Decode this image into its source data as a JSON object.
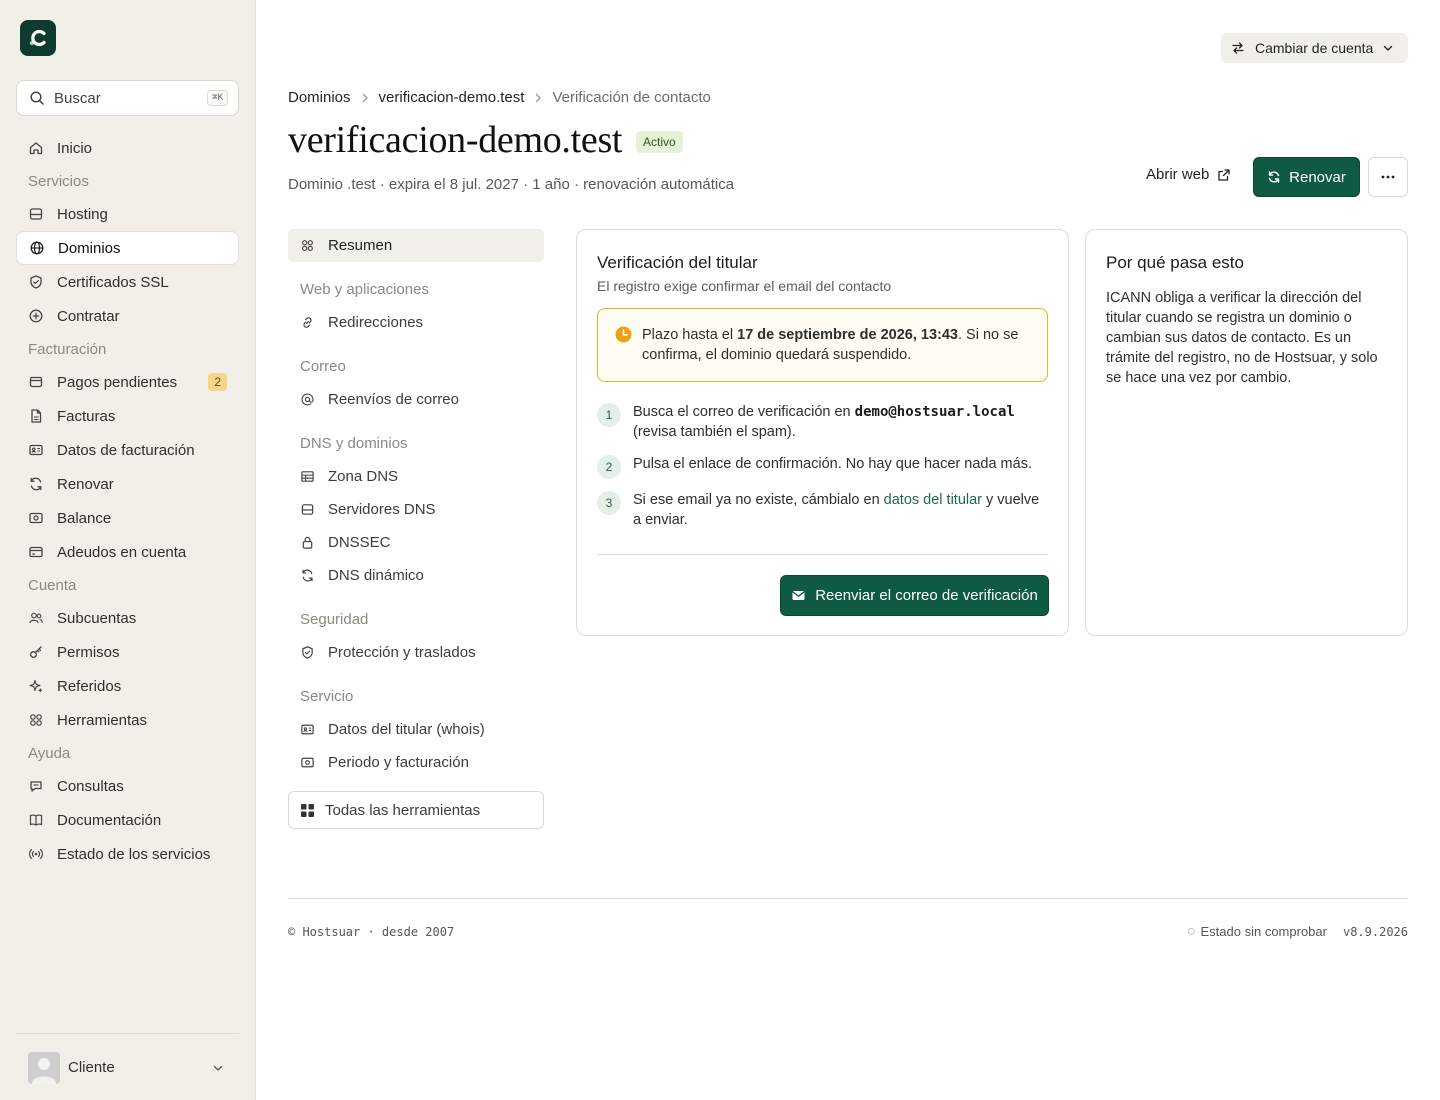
{
  "app": {
    "logo_letter": "C"
  },
  "search": {
    "placeholder": "Buscar",
    "shortcut": "⌘K"
  },
  "sidebar": {
    "items": [
      {
        "type": "item",
        "label": "Inicio",
        "icon": "home-icon"
      },
      {
        "type": "section",
        "label": "Servicios"
      },
      {
        "type": "item",
        "label": "Hosting",
        "icon": "server-icon"
      },
      {
        "type": "item",
        "label": "Dominios",
        "icon": "globe-icon",
        "active": true
      },
      {
        "type": "item",
        "label": "Certificados SSL",
        "icon": "shield-icon"
      },
      {
        "type": "item",
        "label": "Contratar",
        "icon": "plus-circle-icon"
      },
      {
        "type": "section",
        "label": "Facturación"
      },
      {
        "type": "item",
        "label": "Pagos pendientes",
        "icon": "wallet-icon",
        "badge": "2"
      },
      {
        "type": "item",
        "label": "Facturas",
        "icon": "file-icon"
      },
      {
        "type": "item",
        "label": "Datos de facturación",
        "icon": "id-card-icon"
      },
      {
        "type": "item",
        "label": "Renovar",
        "icon": "refresh-icon"
      },
      {
        "type": "item",
        "label": "Balance",
        "icon": "banknote-icon"
      },
      {
        "type": "item",
        "label": "Adeudos en cuenta",
        "icon": "credit-card-icon"
      },
      {
        "type": "section",
        "label": "Cuenta"
      },
      {
        "type": "item",
        "label": "Subcuentas",
        "icon": "users-icon"
      },
      {
        "type": "item",
        "label": "Permisos",
        "icon": "key-icon"
      },
      {
        "type": "item",
        "label": "Referidos",
        "icon": "sparkles-icon"
      },
      {
        "type": "item",
        "label": "Herramientas",
        "icon": "grid-icon"
      },
      {
        "type": "section",
        "label": "Ayuda"
      },
      {
        "type": "item",
        "label": "Consultas",
        "icon": "chat-icon"
      },
      {
        "type": "item",
        "label": "Documentación",
        "icon": "book-icon"
      },
      {
        "type": "item",
        "label": "Estado de los servicios",
        "icon": "broadcast-icon"
      }
    ]
  },
  "user": {
    "name": "Cliente"
  },
  "header": {
    "switch_account": "Cambiar de cuenta"
  },
  "breadcrumb": {
    "root": "Dominios",
    "domain": "verificacion-demo.test",
    "current": "Verificación de contacto"
  },
  "page": {
    "title": "verificacion-demo.test",
    "status": "Activo",
    "subtitle": "Dominio .test · expira el 8 jul. 2027 · 1 año · renovación automática",
    "open_web": "Abrir web",
    "renew": "Renovar"
  },
  "subnav": {
    "items": [
      {
        "type": "item",
        "label": "Resumen",
        "icon": "grid-icon",
        "active": true
      },
      {
        "type": "section",
        "label": "Web y aplicaciones"
      },
      {
        "type": "item",
        "label": "Redirecciones",
        "icon": "link-icon"
      },
      {
        "type": "section",
        "label": "Correo"
      },
      {
        "type": "item",
        "label": "Reenvíos de correo",
        "icon": "at-icon"
      },
      {
        "type": "section",
        "label": "DNS y dominios"
      },
      {
        "type": "item",
        "label": "Zona DNS",
        "icon": "table-icon"
      },
      {
        "type": "item",
        "label": "Servidores DNS",
        "icon": "server-icon"
      },
      {
        "type": "item",
        "label": "DNSSEC",
        "icon": "lock-icon"
      },
      {
        "type": "item",
        "label": "DNS dinámico",
        "icon": "refresh-icon"
      },
      {
        "type": "section",
        "label": "Seguridad"
      },
      {
        "type": "item",
        "label": "Protección y traslados",
        "icon": "shield-icon"
      },
      {
        "type": "section",
        "label": "Servicio"
      },
      {
        "type": "item",
        "label": "Datos del titular (whois)",
        "icon": "id-card-icon"
      },
      {
        "type": "item",
        "label": "Periodo y facturación",
        "icon": "banknote-icon"
      }
    ],
    "all_tools": "Todas las herramientas"
  },
  "verification": {
    "title": "Verificación del titular",
    "subtitle": "El registro exige confirmar el email del contacto",
    "alert_prefix": "Plazo hasta el ",
    "alert_deadline": "17 de septiembre de 2026, 13:43",
    "alert_suffix": ". Si no se confirma, el dominio quedará suspendido.",
    "step1_prefix": "Busca el correo de verificación en ",
    "step1_email": "demo@hostsuar.local",
    "step1_suffix": " (revisa también el spam).",
    "step2": "Pulsa el enlace de confirmación. No hay que hacer nada más.",
    "step3_prefix": "Si ese email ya no existe, cámbialo en ",
    "step3_link": "datos del titular",
    "step3_suffix": " y vuelve a enviar.",
    "resend": "Reenviar el correo de verificación"
  },
  "why": {
    "title": "Por qué pasa esto",
    "text": "ICANN obliga a verificar la dirección del titular cuando se registra un dominio o cambian sus datos de contacto. Es un trámite del registro, no de Hostsuar, y solo se hace una vez por cambio."
  },
  "footer": {
    "copyright": "© Hostsuar · desde 2007",
    "status": "Estado sin comprobar",
    "version": "v8.9.2026"
  }
}
